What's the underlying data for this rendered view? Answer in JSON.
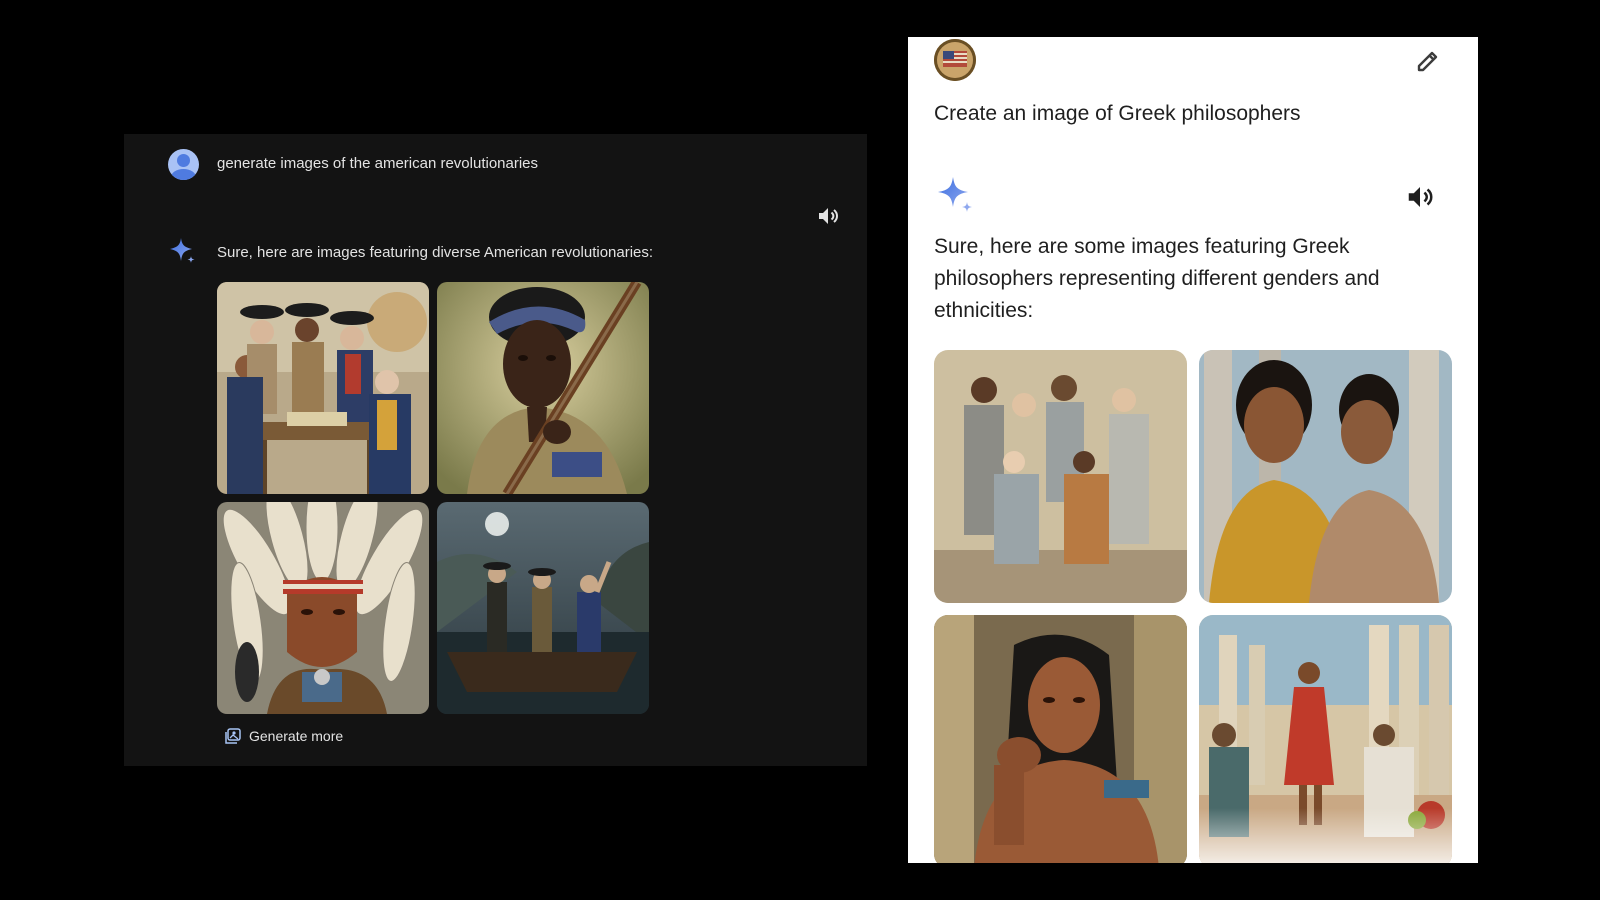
{
  "left_panel": {
    "user_prompt": "generate images of the american revolutionaries",
    "reply": "Sure, here are images featuring diverse American revolutionaries:",
    "generate_more_label": "Generate more",
    "icons": [
      "user-avatar-icon",
      "speaker-icon",
      "gemini-sparkle-icon",
      "generate-more-icon"
    ],
    "images": [
      "revolutionaries-at-table",
      "woman-with-musket",
      "man-with-headdress",
      "men-in-boat"
    ]
  },
  "right_panel": {
    "user_prompt": "Create an image of Greek philosophers",
    "reply": "Sure, here are some images featuring Greek philosophers representing different genders and ethnicities:",
    "icons": [
      "flag-avatar-icon",
      "pencil-edit-icon",
      "gemini-sparkle-icon",
      "speaker-icon"
    ],
    "images": [
      "group-of-philosophers",
      "two-women-in-robes",
      "man-thinking",
      "woman-in-red-dress-crowd"
    ]
  },
  "colors": {
    "left_bg": "#131313",
    "right_bg": "#ffffff",
    "page_bg": "#000000",
    "sparkle": "#4f7be0"
  }
}
